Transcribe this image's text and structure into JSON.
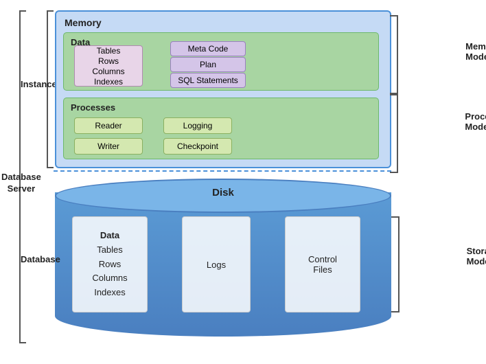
{
  "labels": {
    "memory": "Memory",
    "data": "Data",
    "processes": "Processes",
    "instance": "Instance",
    "memory_model": "Memory\nModel",
    "process_model": "Process\nModel",
    "database_server": "Database\nServer",
    "database": "Database",
    "storage_model": "Storage\nModel",
    "disk": "Disk"
  },
  "data_items": [
    "Tables",
    "Rows",
    "Columns",
    "Indexes"
  ],
  "meta_buttons": [
    "Meta Code",
    "Plan",
    "SQL Statements"
  ],
  "process_buttons": [
    "Reader",
    "Logging",
    "Writer",
    "Checkpoint"
  ],
  "disk_cards": [
    {
      "lines": [
        "Data",
        "Tables",
        "Rows",
        "Columns",
        "Indexes"
      ]
    },
    {
      "lines": [
        "Logs"
      ]
    },
    {
      "lines": [
        "Control",
        "Files"
      ]
    }
  ]
}
